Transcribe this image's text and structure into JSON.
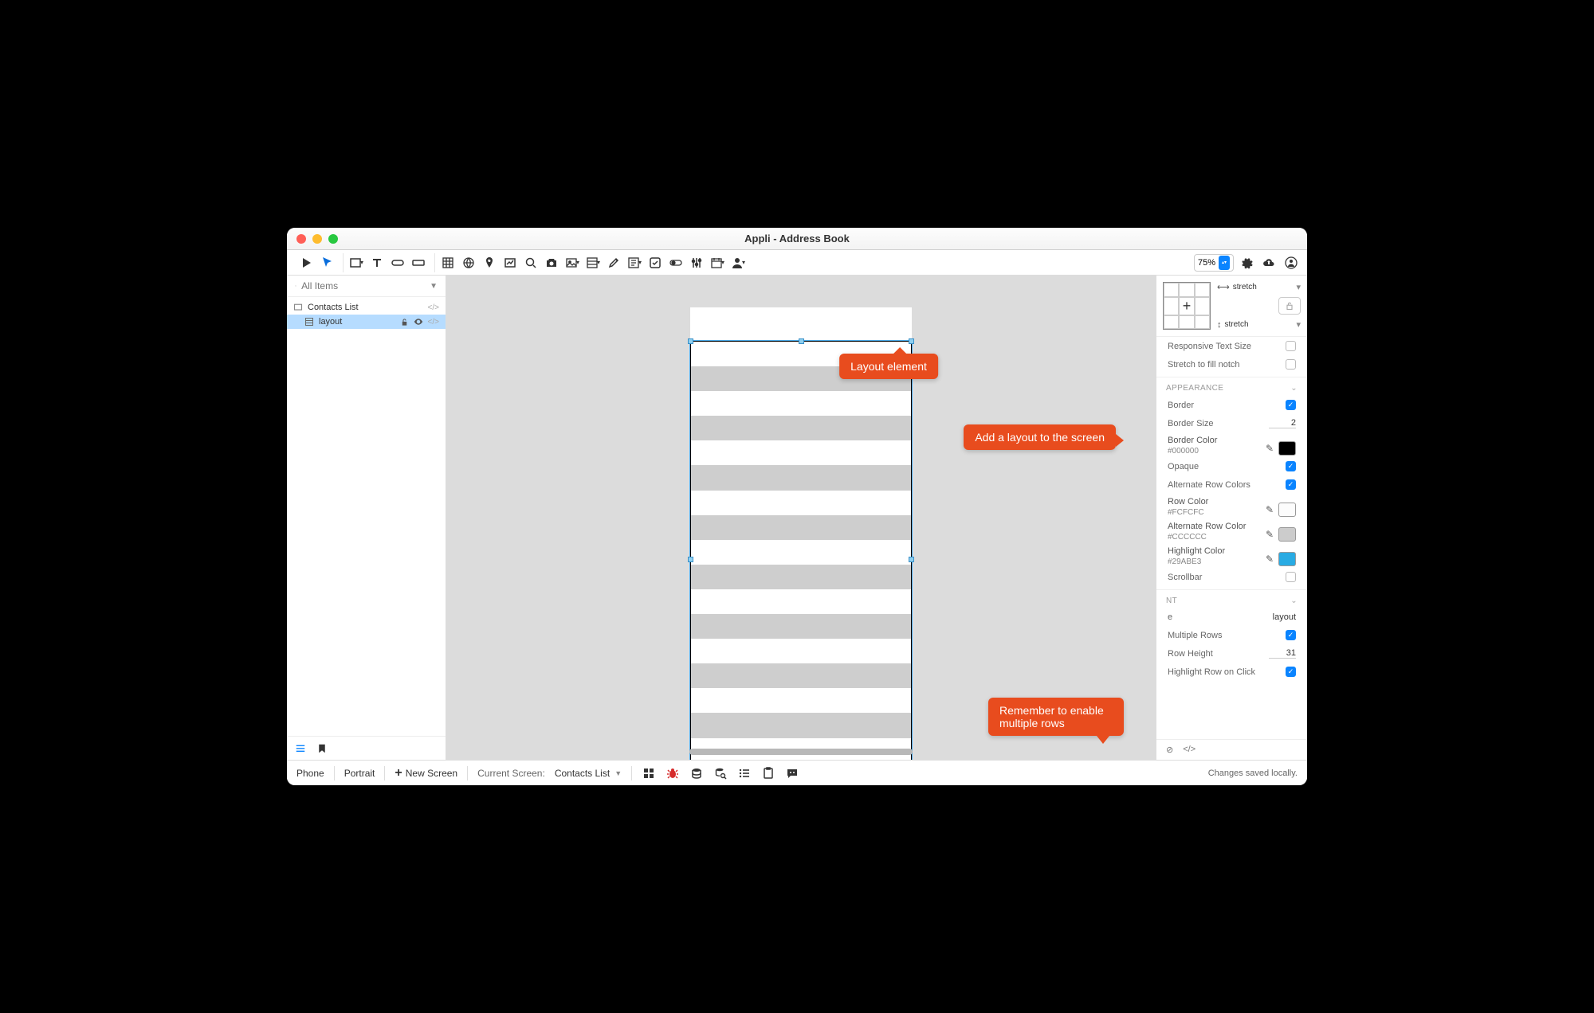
{
  "window": {
    "title": "Appli - Address Book"
  },
  "toolbar": {
    "zoom": "75%"
  },
  "sidebar": {
    "search_placeholder": "All Items",
    "items": [
      {
        "label": "Contacts List"
      },
      {
        "label": "layout"
      }
    ]
  },
  "callouts": {
    "layout_element": "Layout element",
    "add_layout": "Add a layout to the screen",
    "multiple_rows": "Remember to enable multiple rows"
  },
  "inspector": {
    "h_stretch": "stretch",
    "v_stretch": "stretch",
    "responsive_text": "Responsive Text Size",
    "stretch_notch": "Stretch to fill notch",
    "appearance_head": "APPEARANCE",
    "border_label": "Border",
    "border_size_label": "Border Size",
    "border_size_value": "2",
    "border_color_label": "Border Color",
    "border_color_value": "#000000",
    "opaque_label": "Opaque",
    "alt_rows_label": "Alternate Row Colors",
    "row_color_label": "Row Color",
    "row_color_value": "#FCFCFC",
    "alt_row_color_label": "Alternate Row Color",
    "alt_row_color_value": "#CCCCCC",
    "highlight_color_label": "Highlight Color",
    "highlight_color_value": "#29ABE3",
    "scrollbar_label": "Scrollbar",
    "content_head": "NT",
    "name_label": "e",
    "name_value": "layout",
    "multiple_rows_label": "Multiple Rows",
    "row_height_label": "Row Height",
    "row_height_value": "31",
    "highlight_click_label": "Highlight Row on Click"
  },
  "statusbar": {
    "device": "Phone",
    "orientation": "Portrait",
    "new_screen": "New Screen",
    "current_label": "Current Screen:",
    "current_value": "Contacts List",
    "save_status": "Changes saved locally."
  }
}
